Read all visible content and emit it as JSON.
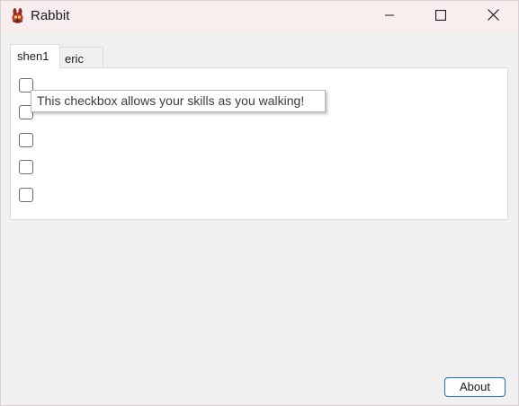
{
  "window": {
    "title": "Rabbit",
    "icon": "rabbit-app-icon",
    "controls": {
      "minimize_icon": "minimize-icon",
      "maximize_icon": "maximize-icon",
      "close_icon": "close-icon"
    }
  },
  "tabs": [
    {
      "label": "shen1",
      "active": true
    },
    {
      "label": "eric",
      "active": false
    }
  ],
  "checkboxes": [
    {
      "checked": false
    },
    {
      "checked": false
    },
    {
      "checked": false
    },
    {
      "checked": false
    },
    {
      "checked": false
    }
  ],
  "tooltip": {
    "text": "This checkbox allows your skills as you walking!"
  },
  "footer": {
    "about_label": "About"
  },
  "colors": {
    "titlebar": "#f9eeee",
    "accent": "#1f6fc9",
    "background": "#f0f0f0"
  }
}
